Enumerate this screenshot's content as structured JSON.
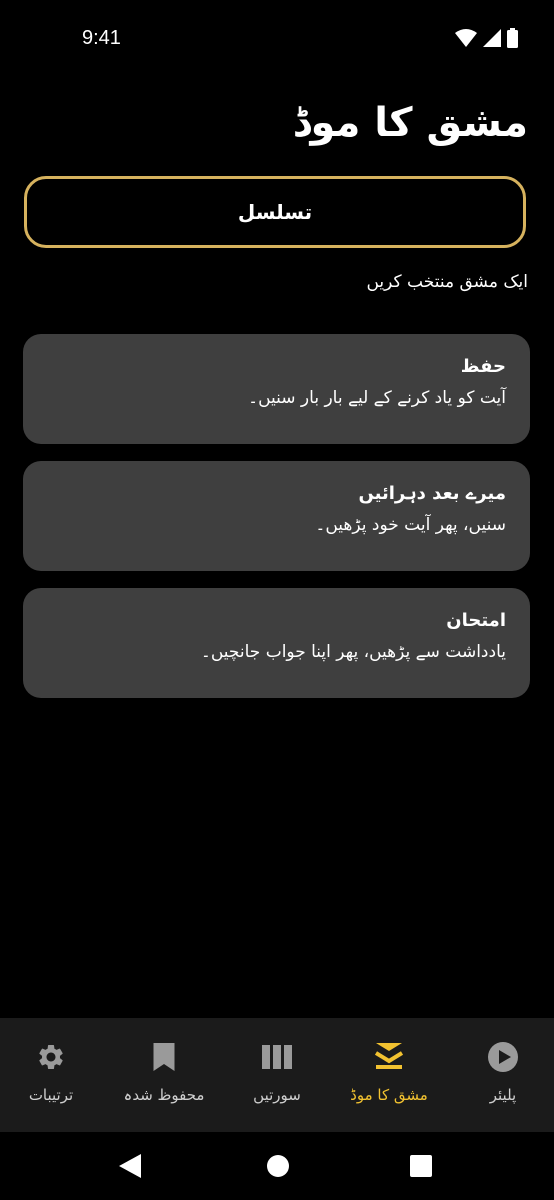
{
  "status": {
    "time": "9:41"
  },
  "page": {
    "title": "مشق کا موڈ",
    "sequence_button": "تسلسل",
    "hint": "ایک مشق منتخب کریں"
  },
  "modes": [
    {
      "title": "حفظ",
      "description": "آیت کو یاد کرنے کے لیے بار بار سنیں۔"
    },
    {
      "title": "میرے بعد دہرائیں",
      "description": "سنیں، پھر آیت خود پڑھیں۔"
    },
    {
      "title": "امتحان",
      "description": "یادداشت سے پڑھیں، پھر اپنا جواب جانچیں۔"
    }
  ],
  "nav": {
    "settings": {
      "label": "ترتیبات",
      "icon": "gear-icon"
    },
    "saved": {
      "label": "محفوظ شدہ",
      "icon": "bookmark-icon"
    },
    "surahs": {
      "label": "سورتیں",
      "icon": "library-icon"
    },
    "practice": {
      "label": "مشق کا موڈ",
      "icon": "layers-icon",
      "active": true
    },
    "player": {
      "label": "پلیئر",
      "icon": "play-circle-icon"
    }
  },
  "colors": {
    "accent": "#F2C230",
    "border": "#D6B25E",
    "card": "#3F3F3F",
    "nav_bg": "#1B1B1B"
  }
}
